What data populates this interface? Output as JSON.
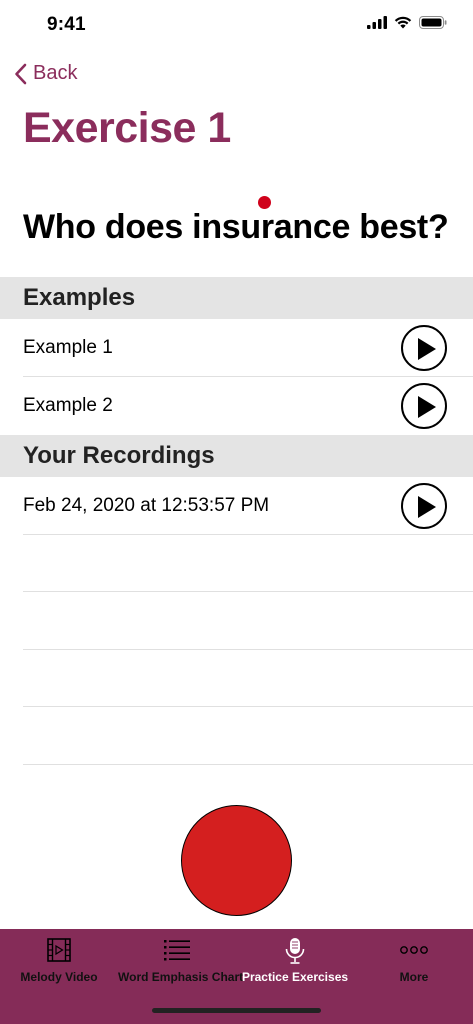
{
  "status": {
    "time": "9:41"
  },
  "nav": {
    "back_label": "Back"
  },
  "page": {
    "title": "Exercise 1",
    "question": "Who does insurance best?"
  },
  "examples": {
    "header": "Examples",
    "items": [
      {
        "label": "Example 1"
      },
      {
        "label": "Example 2"
      }
    ]
  },
  "recordings": {
    "header": "Your Recordings",
    "items": [
      {
        "label": "Feb 24, 2020 at 12:53:57 PM"
      }
    ]
  },
  "tabs": [
    {
      "label": "Melody Video",
      "icon": "film-icon",
      "active": false
    },
    {
      "label": "Word Emphasis Chart",
      "icon": "list-icon",
      "active": false
    },
    {
      "label": "Practice Exercises",
      "icon": "microphone-icon",
      "active": true
    },
    {
      "label": "More",
      "icon": "more-dots-icon",
      "active": false
    }
  ],
  "colors": {
    "accent": "#8b2d5c",
    "tab_bar": "#852c58",
    "record": "#d41f1f",
    "dot": "#d0021b"
  }
}
